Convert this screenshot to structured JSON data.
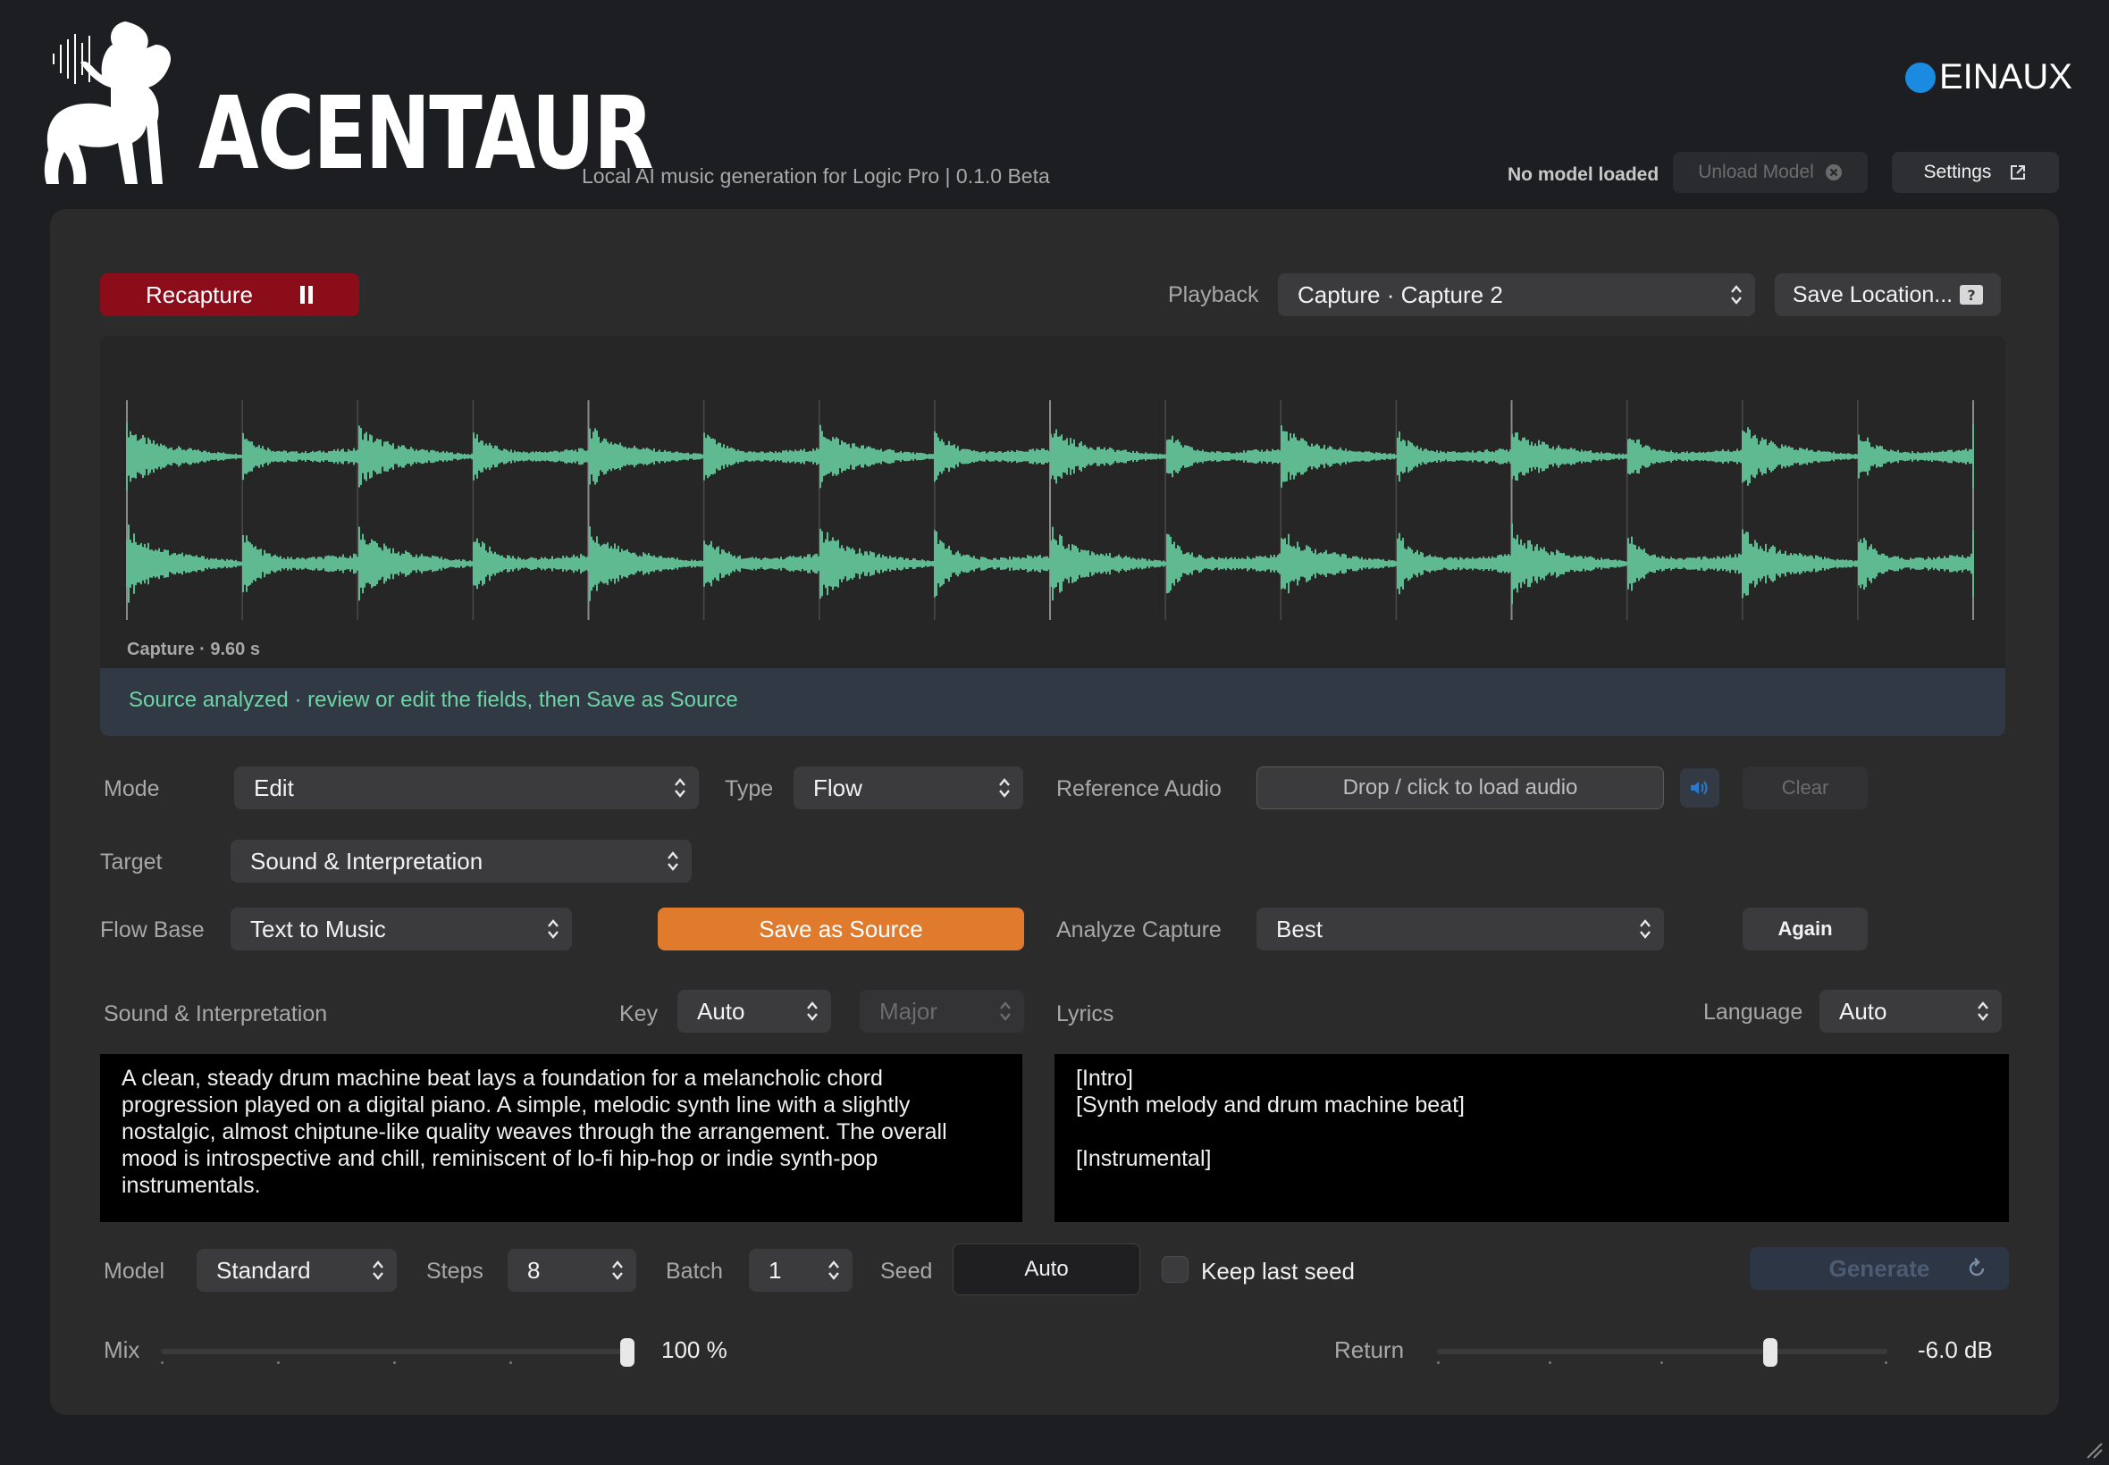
{
  "header": {
    "app_name": "ACENTAUR",
    "tagline": "Local AI music generation for Logic Pro | 0.1.0 Beta",
    "brand": "EINAUX",
    "model_status": "No model loaded",
    "unload_label": "Unload Model",
    "settings_label": "Settings"
  },
  "capture": {
    "recapture_label": "Recapture",
    "playback_label": "Playback",
    "playback_value": "Capture · Capture 2",
    "save_location_label": "Save Location...",
    "waveform_caption": "Capture · 9.60 s",
    "status_message": "Source analyzed · review or edit the fields, then Save as Source"
  },
  "controls": {
    "mode_label": "Mode",
    "mode_value": "Edit",
    "type_label": "Type",
    "type_value": "Flow",
    "reference_label": "Reference Audio",
    "reference_drop": "Drop / click to load audio",
    "clear_label": "Clear",
    "target_label": "Target",
    "target_value": "Sound & Interpretation",
    "flow_base_label": "Flow Base",
    "flow_base_value": "Text to Music",
    "save_source_label": "Save as Source",
    "analyze_label": "Analyze Capture",
    "analyze_value": "Best",
    "again_label": "Again"
  },
  "sound": {
    "section_label": "Sound & Interpretation",
    "key_label": "Key",
    "key_value": "Auto",
    "scale_value": "Major",
    "description": "A clean, steady drum machine beat lays a foundation for a melancholic chord progression played on a digital piano. A simple, melodic synth line with a slightly nostalgic, almost chiptune-like quality weaves through the arrangement. The overall mood is introspective and chill, reminiscent of lo-fi hip-hop or indie synth-pop instrumentals."
  },
  "lyrics": {
    "section_label": "Lyrics",
    "language_label": "Language",
    "language_value": "Auto",
    "text": "[Intro]\n[Synth melody and drum machine beat]\n\n[Instrumental]"
  },
  "generation": {
    "model_label": "Model",
    "model_value": "Standard",
    "steps_label": "Steps",
    "steps_value": "8",
    "batch_label": "Batch",
    "batch_value": "1",
    "seed_label": "Seed",
    "seed_value": "Auto",
    "keep_seed_label": "Keep last seed",
    "generate_label": "Generate"
  },
  "mix": {
    "mix_label": "Mix",
    "mix_value": "100 %",
    "mix_level": 1.0,
    "return_label": "Return",
    "return_value": "-6.0 dB",
    "return_level": 0.74
  },
  "colors": {
    "accent_red": "#8b0d1a",
    "accent_orange": "#e07b2e",
    "waveform": "#5fb991",
    "status_text": "#6ed4a6",
    "brand_blue": "#1a8be0"
  },
  "icons": [
    "centaur-logo",
    "close-circle-icon",
    "external-link-icon",
    "pause-icon",
    "chevron-updown-icon",
    "help-icon",
    "speaker-icon",
    "refresh-icon",
    "resize-grip-icon"
  ]
}
